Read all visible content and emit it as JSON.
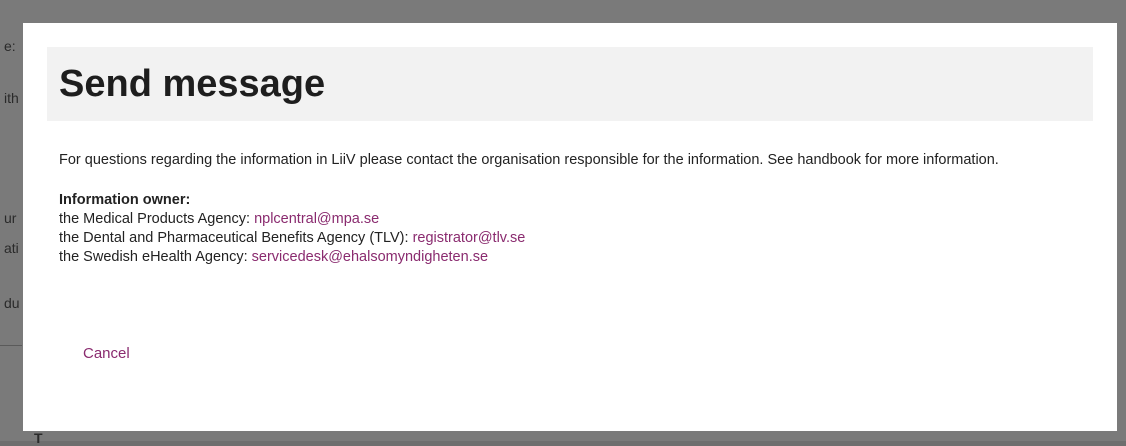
{
  "background_fragments": [
    "e:",
    "ith",
    "ur",
    "ati",
    "du",
    "T"
  ],
  "dialog": {
    "title": "Send message",
    "intro": "For questions regarding the information in LiiV please contact the organisation responsible for the information. See handbook for more information.",
    "owner_heading": "Information owner:",
    "owners": [
      {
        "label": "the Medical Products Agency: ",
        "email": "nplcentral@mpa.se"
      },
      {
        "label": "the Dental and Pharmaceutical Benefits Agency (TLV): ",
        "email": "registrator@tlv.se"
      },
      {
        "label": "the Swedish eHealth Agency: ",
        "email": "servicedesk@ehalsomyndigheten.se"
      }
    ],
    "cancel_label": "Cancel"
  },
  "colors": {
    "overlay": "#6e6e6e",
    "header_bg": "#f2f2f2",
    "link": "#8a2b6f",
    "text": "#222222"
  }
}
